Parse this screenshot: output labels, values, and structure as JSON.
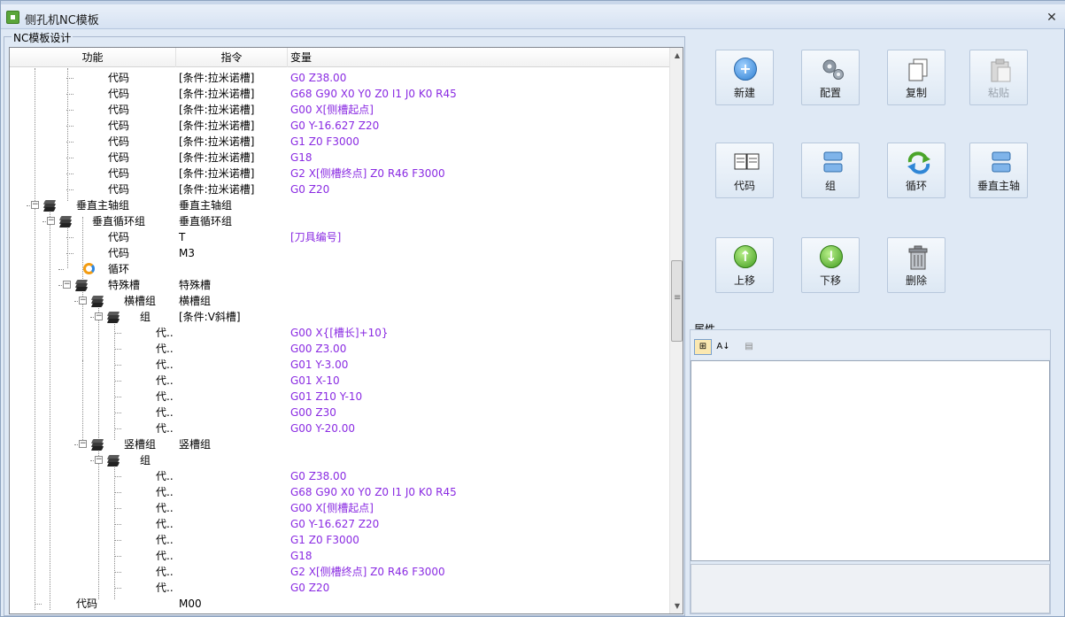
{
  "window": {
    "title": "侧孔机NC模板",
    "close_glyph": "✕"
  },
  "group_title": "NC模板设计",
  "columns": {
    "func": "功能",
    "cmd": "指令",
    "var": "变量"
  },
  "rows": [
    {
      "func": "代码",
      "cmd": "[条件:拉米诺槽]",
      "var": "G0 Z38.00"
    },
    {
      "func": "代码",
      "cmd": "[条件:拉米诺槽]",
      "var": "G68 G90 X0 Y0 Z0 I1 J0 K0 R45"
    },
    {
      "func": "代码",
      "cmd": "[条件:拉米诺槽]",
      "var": "G00 X[侧槽起点]"
    },
    {
      "func": "代码",
      "cmd": "[条件:拉米诺槽]",
      "var": "G0 Y-16.627 Z20"
    },
    {
      "func": "代码",
      "cmd": "[条件:拉米诺槽]",
      "var": "G1 Z0 F3000"
    },
    {
      "func": "代码",
      "cmd": "[条件:拉米诺槽]",
      "var": "G18"
    },
    {
      "func": "代码",
      "cmd": "[条件:拉米诺槽]",
      "var": "G2 X[侧槽终点] Z0 R46 F3000"
    },
    {
      "func": "代码",
      "cmd": "[条件:拉米诺槽]",
      "var": "G0 Z20"
    },
    {
      "func": "垂直主轴组",
      "cmd": "垂直主轴组",
      "var": ""
    },
    {
      "func": "垂直循环组",
      "cmd": "垂直循环组",
      "var": ""
    },
    {
      "func": "代码",
      "cmd": "T",
      "var": "[刀具编号]"
    },
    {
      "func": "代码",
      "cmd": "M3",
      "var": ""
    },
    {
      "func": "循环",
      "cmd": "",
      "var": ""
    },
    {
      "func": "特殊槽",
      "cmd": "特殊槽",
      "var": ""
    },
    {
      "func": "横槽组",
      "cmd": "横槽组",
      "var": ""
    },
    {
      "func": "组",
      "cmd": "[条件:V斜槽]",
      "var": ""
    },
    {
      "func": "代..",
      "cmd": "",
      "var": "G00 X{[槽长]+10}"
    },
    {
      "func": "代..",
      "cmd": "",
      "var": "G00 Z3.00"
    },
    {
      "func": "代..",
      "cmd": "",
      "var": "G01 Y-3.00"
    },
    {
      "func": "代..",
      "cmd": "",
      "var": "G01 X-10"
    },
    {
      "func": "代..",
      "cmd": "",
      "var": "G01 Z10 Y-10"
    },
    {
      "func": "代..",
      "cmd": "",
      "var": "G00 Z30"
    },
    {
      "func": "代..",
      "cmd": "",
      "var": "G00 Y-20.00"
    },
    {
      "func": "竖槽组",
      "cmd": "竖槽组",
      "var": ""
    },
    {
      "func": "组",
      "cmd": "",
      "var": ""
    },
    {
      "func": "代..",
      "cmd": "",
      "var": "G0 Z38.00"
    },
    {
      "func": "代..",
      "cmd": "",
      "var": "G68 G90 X0 Y0 Z0 I1 J0 K0 R45"
    },
    {
      "func": "代..",
      "cmd": "",
      "var": "G00 X[侧槽起点]"
    },
    {
      "func": "代..",
      "cmd": "",
      "var": "G0 Y-16.627 Z20"
    },
    {
      "func": "代..",
      "cmd": "",
      "var": "G1 Z0 F3000"
    },
    {
      "func": "代..",
      "cmd": "",
      "var": "G18"
    },
    {
      "func": "代..",
      "cmd": "",
      "var": "G2 X[侧槽终点] Z0 R46 F3000"
    },
    {
      "func": "代..",
      "cmd": "",
      "var": "G0 Z20"
    },
    {
      "func": "代码",
      "cmd": "M00",
      "var": ""
    }
  ],
  "toolbar": {
    "new": "新建",
    "config": "配置",
    "copy": "复制",
    "paste": "粘贴",
    "code": "代码",
    "group": "组",
    "loop": "循环",
    "vspindle": "垂直主轴",
    "up": "上移",
    "down": "下移",
    "delete": "删除"
  },
  "properties": {
    "label": "属性",
    "categorized_glyph": "⊞",
    "sort_glyph": "A↓",
    "pages_glyph": "▤"
  },
  "icons": {
    "app": "app-window-icon",
    "new": "plus-circle-icon",
    "config": "gears-icon",
    "copy": "documents-icon",
    "paste": "clipboard-icon",
    "code": "book-icon",
    "group": "group-blocks-icon",
    "loop": "refresh-arrows-icon",
    "vspindle": "group-blocks-icon",
    "up": "arrow-up-circle-icon",
    "down": "arrow-down-circle-icon",
    "delete": "trash-icon",
    "layer": "layers-icon",
    "loop_node": "loop-icon"
  },
  "colors": {
    "variable_text": "#8a2be2",
    "accent_blue": "#2f7fd1",
    "accent_green": "#3f9b1e"
  }
}
